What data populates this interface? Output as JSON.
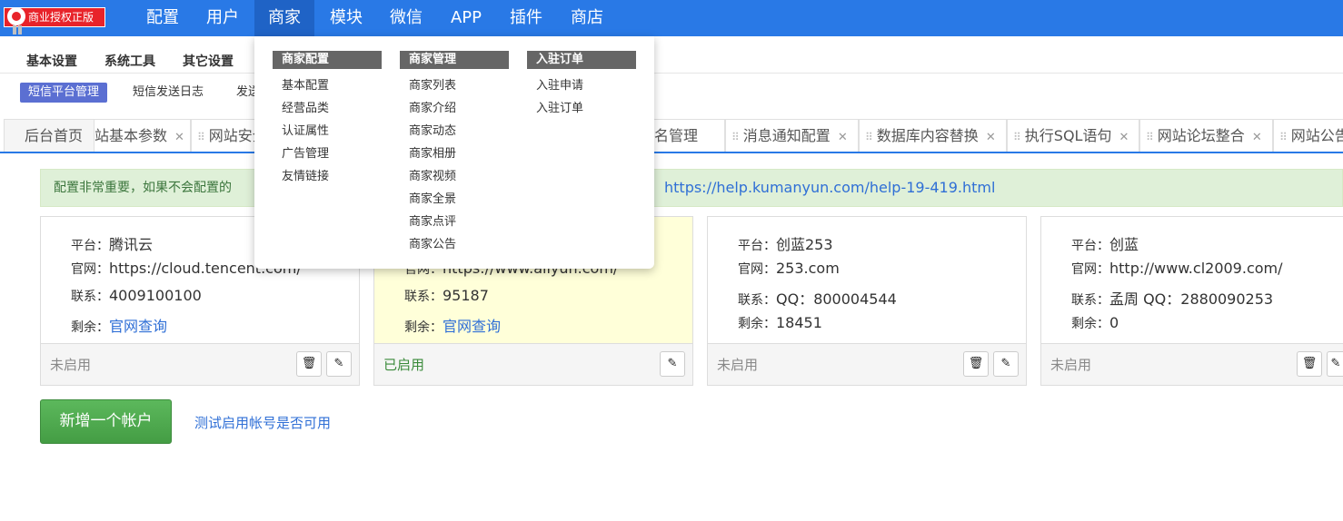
{
  "logo": {
    "text": "商业授权正版"
  },
  "topnav": [
    "配置",
    "用户",
    "商家",
    "模块",
    "微信",
    "APP",
    "插件",
    "商店"
  ],
  "subnav1": [
    "基本设置",
    "系统工具",
    "其它设置"
  ],
  "subnav2": [
    "短信平台管理",
    "短信发送日志",
    "发送"
  ],
  "tabs": [
    "后台首页",
    "站基本参数",
    "网站安全",
    "名管理",
    "消息通知配置",
    "数据库内容替换",
    "执行SQL语句",
    "网站论坛整合",
    "网站公告"
  ],
  "alert": {
    "text": "配置非常重要，如果不会配置的",
    "link": "https://help.kumanyun.com/help-19-419.html"
  },
  "labels": {
    "platform": "平台：",
    "site": "官网：",
    "contact": "联系：",
    "remain": "剩余："
  },
  "cards": [
    {
      "platform": "腾讯云",
      "site": "https://cloud.tencent.com/",
      "contact": "4009100100",
      "remain": "官网查询",
      "status": "未启用"
    },
    {
      "platform": "",
      "site": "https://www.aliyun.com/",
      "contact": "95187",
      "remain": "官网查询",
      "status": "已启用"
    },
    {
      "platform": "创蓝253",
      "site": "253.com",
      "contact": "QQ：800004544",
      "remain": "18451",
      "status": "未启用"
    },
    {
      "platform": "创蓝",
      "site": "http://www.cl2009.com/",
      "contact": "孟周 QQ：2880090253",
      "remain": "0",
      "status": "未启用"
    }
  ],
  "add_button": "新增一个帐户",
  "test_link": "测试启用帐号是否可用",
  "dropdown": {
    "columns": [
      {
        "title": "商家配置",
        "items": [
          "基本配置",
          "经营品类",
          "认证属性",
          "广告管理",
          "友情链接"
        ]
      },
      {
        "title": "商家管理",
        "items": [
          "商家列表",
          "商家介绍",
          "商家动态",
          "商家相册",
          "商家视频",
          "商家全景",
          "商家点评",
          "商家公告"
        ]
      },
      {
        "title": "入驻订单",
        "items": [
          "入驻申请",
          "入驻订单"
        ]
      }
    ]
  },
  "colors": {
    "topbar": "#2979e6",
    "active_nav": "#1f63c6",
    "enabled_card": "#ffffd9",
    "alert_bg": "#dff0d8",
    "add_button": "#4cae4c"
  }
}
